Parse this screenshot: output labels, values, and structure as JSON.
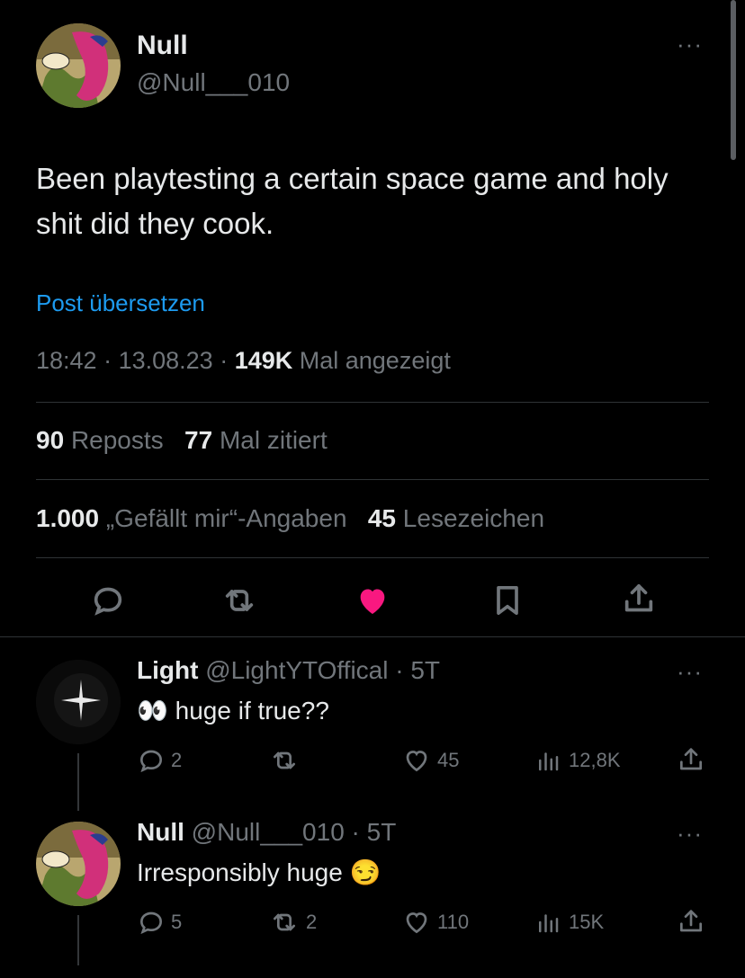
{
  "main_post": {
    "author_name": "Null",
    "author_handle": "@Null___010",
    "text": "Been playtesting a certain space game and holy shit did they cook.",
    "translate_link": "Post übersetzen",
    "time": "18:42",
    "date": "13.08.23",
    "views_count": "149K",
    "views_label": "Mal angezeigt",
    "reposts_count": "90",
    "reposts_label": "Reposts",
    "quotes_count": "77",
    "quotes_label": "Mal zitiert",
    "likes_count": "1.000",
    "likes_label": "„Gefällt mir“-Angaben",
    "bookmarks_count": "45",
    "bookmarks_label": "Lesezeichen"
  },
  "replies": [
    {
      "author_name": "Light",
      "author_handle": "@LightYTOffical",
      "age": "5T",
      "text": "huge if true??",
      "emoji": "👀",
      "reply_count": "2",
      "repost_count": "",
      "like_count": "45",
      "view_count": "12,8K"
    },
    {
      "author_name": "Null",
      "author_handle": "@Null___010",
      "age": "5T",
      "text": "Irresponsibly huge",
      "emoji": "😏",
      "reply_count": "5",
      "repost_count": "2",
      "like_count": "110",
      "view_count": "15K"
    }
  ],
  "colors": {
    "background": "#000000",
    "text": "#e7e9ea",
    "muted": "#71767b",
    "link": "#1d9bf0",
    "like_active": "#f91880",
    "divider": "#2f3336"
  },
  "icons": [
    "more-icon",
    "reply-icon",
    "repost-icon",
    "like-icon",
    "bookmark-icon",
    "share-icon",
    "views-icon"
  ]
}
